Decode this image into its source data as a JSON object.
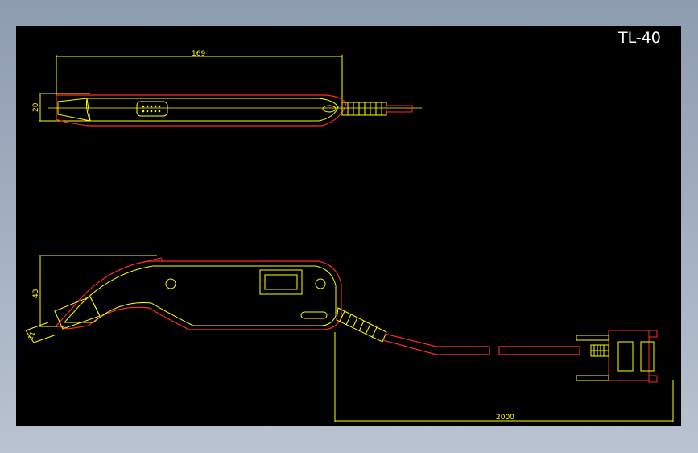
{
  "drawing": {
    "title": "TL-40",
    "dimensions": {
      "top_length": "169",
      "top_height": "20",
      "side_height": "43",
      "tip_size": "11",
      "cable_length": "2000"
    }
  },
  "colors": {
    "background": "#000000",
    "frame": "#8e9cb0",
    "outline": "#ff2a2a",
    "detail": "#ffff00",
    "title": "#ffffff"
  }
}
